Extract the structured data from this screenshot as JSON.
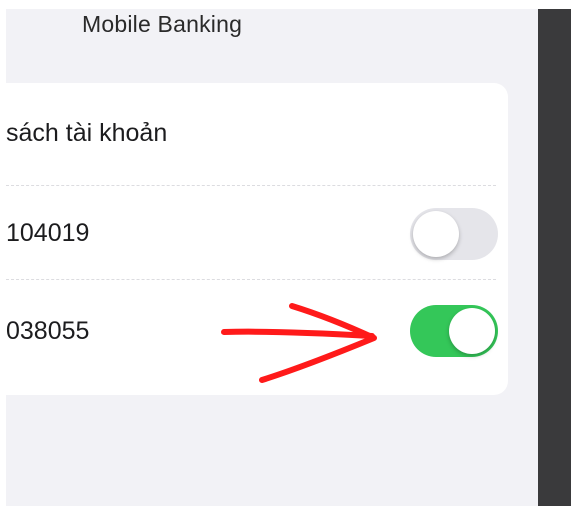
{
  "header": {
    "title": "Mobile Banking"
  },
  "accounts_card": {
    "title": "sách tài khoản",
    "rows": [
      {
        "account": "104019",
        "enabled": false
      },
      {
        "account": "038055",
        "enabled": true
      }
    ]
  },
  "colors": {
    "toggle_on": "#34c759",
    "toggle_off": "#e5e5ea",
    "annotation_arrow": "#ff1a1a"
  },
  "icons": {
    "annotation": "red-arrow-icon"
  }
}
